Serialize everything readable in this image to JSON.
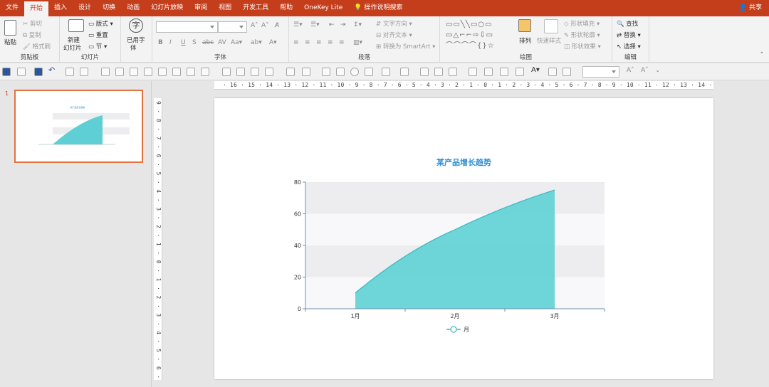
{
  "app": {
    "tabs": [
      "文件",
      "开始",
      "插入",
      "设计",
      "切换",
      "动画",
      "幻灯片放映",
      "审阅",
      "视图",
      "开发工具",
      "帮助",
      "OneKey Lite"
    ],
    "active_tab": "开始",
    "tell_me": "操作说明搜索",
    "share": "共享"
  },
  "ribbon": {
    "clipboard": {
      "label": "剪贴板",
      "paste": "粘贴",
      "cut": "剪切",
      "copy": "复制",
      "format_painter": "格式刷"
    },
    "slides": {
      "label": "幻灯片",
      "new_slide_1": "新建",
      "new_slide_2": "幻灯片",
      "layout": "版式",
      "reset": "重置",
      "section": "节"
    },
    "font_used": {
      "label_1": "已用字",
      "label_2": "体"
    },
    "font": {
      "label": "字体"
    },
    "paragraph": {
      "label": "段落",
      "text_direction": "文字方向",
      "align_text": "对齐文本",
      "smartart": "转换为 SmartArt"
    },
    "drawing": {
      "label": "绘图",
      "arrange": "排列",
      "quick_styles": "快速样式",
      "shape_fill": "形状填充",
      "shape_outline": "形状轮廓",
      "shape_effects": "形状效果"
    },
    "editing": {
      "label": "编辑",
      "find": "查找",
      "replace": "替换",
      "select": "选择"
    }
  },
  "rulers": {
    "horizontal": "· 16 · 15 · 14 · 13 · 12 · 11 · 10 · 9 · 8 · 7 · 6 · 5 · 4 · 3 · 2 · 1 · 0 · 1 · 2 · 3 · 4 · 5 · 6 · 7 · 8 · 9 · 10 · 11 · 12 · 13 · 14 · 15 · 16 ·",
    "vertical": "9 · 8 · 7 · 6 · 5 · 4 · 3 · 2 · 1 · 0 · 1 · 2 · 3 · 4 · 5 · 6 · 7 · 8 · 9"
  },
  "thumbnail": {
    "slide_number": "1"
  },
  "colors": {
    "accent": "#c43e1c",
    "area_fill": "#5ed0d5",
    "area_line": "#3cb8bf",
    "title": "#2f8fd1",
    "band": "#ededf0",
    "axis": "#6f8fb0"
  },
  "chart_data": {
    "type": "area",
    "title": "某产品增长趋势",
    "categories": [
      "1月",
      "2月",
      "3月"
    ],
    "series": [
      {
        "name": "月",
        "values": [
          10,
          50,
          75
        ]
      }
    ],
    "ylim": [
      0,
      80
    ],
    "yticks": [
      0,
      20,
      40,
      60,
      80
    ],
    "grid": "alternating horizontal bands",
    "legend": "bottom-center",
    "smooth": true
  }
}
